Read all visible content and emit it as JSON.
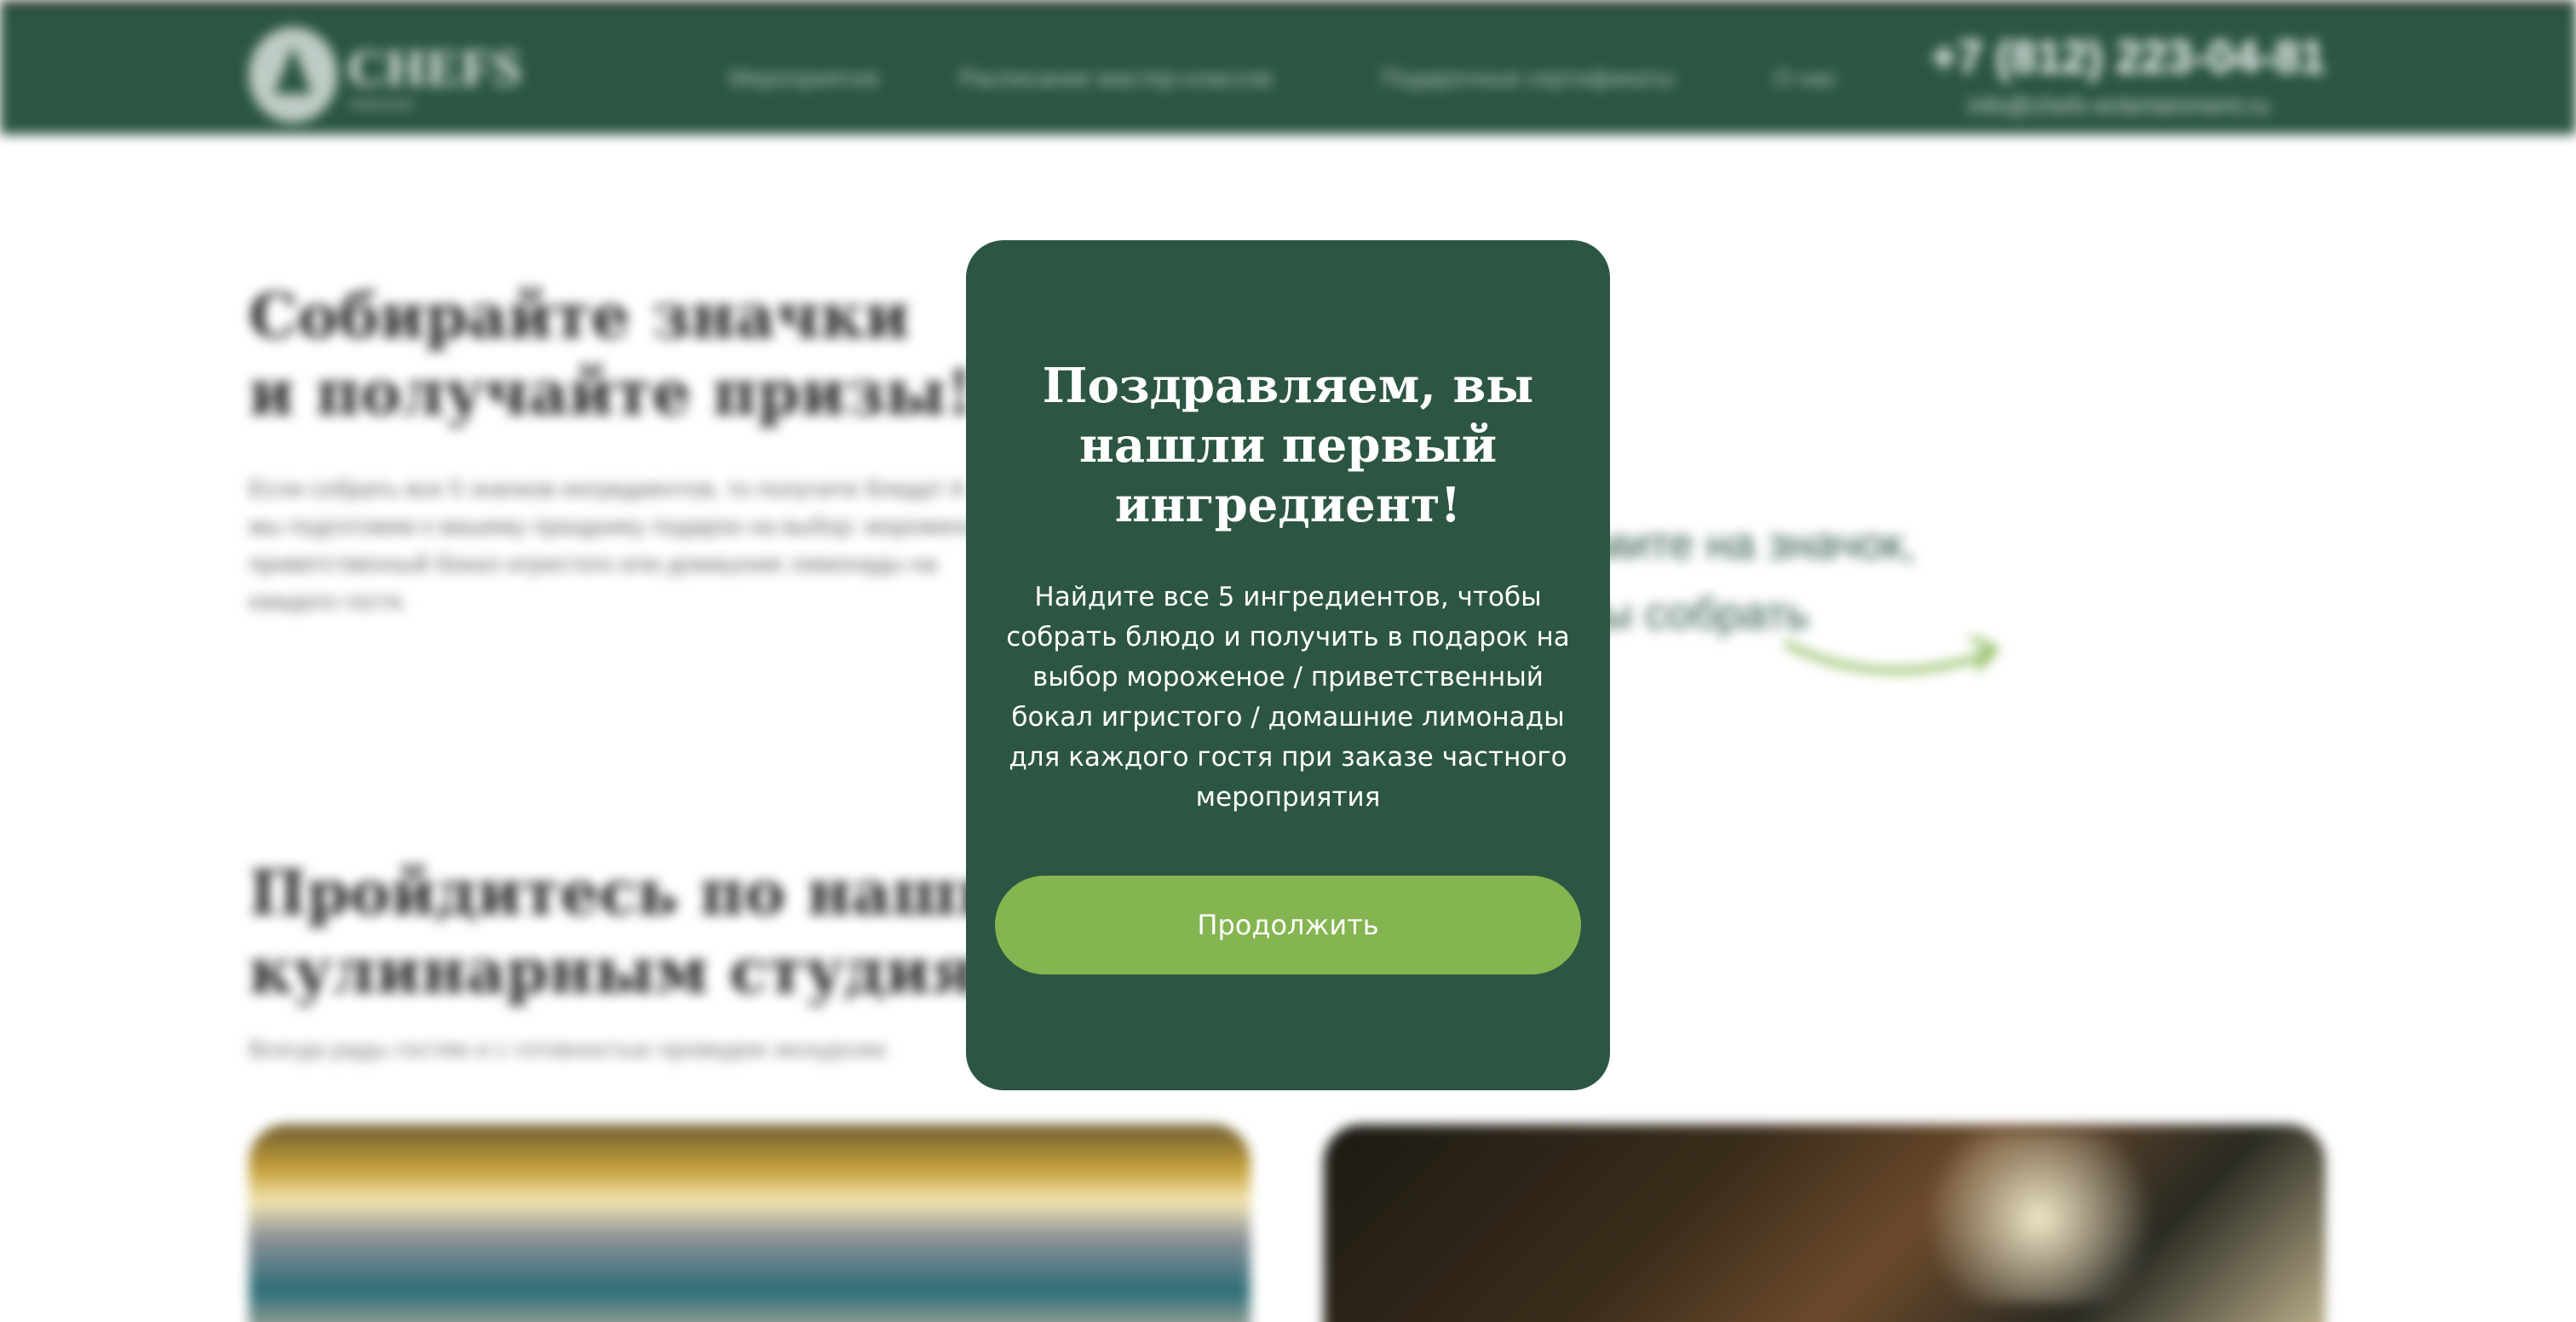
{
  "header": {
    "logo_text": "CHEFS",
    "logo_sub": "Masterclass",
    "nav": [
      "Мероприятия",
      "Расписание мастер-классов",
      "Подарочные сертификаты",
      "О нас"
    ],
    "phone": "+7 (812) 223-04-81",
    "email": "info@chefs-entertainment.ru"
  },
  "background": {
    "heading_line1": "Собирайте значки",
    "heading_line2": "и получайте призы!",
    "paragraph": "Если собрать все 5 значков ингредиентов, то получите блюдо! А мы подготовим к вашему празднику подарок на выбор: мороженое, приветственный бокал игристого или домашние лимонады на каждого гостя.",
    "side_text_line1": "Нажмите на значок,",
    "side_text_line2": "чтобы собрать",
    "heading2_line1": "Пройдитесь по нашим",
    "heading2_line2": "кулинарным студиям",
    "paragraph2": "Всегда рады гостям и с готовностью проведем экскурсию"
  },
  "modal": {
    "title": "Поздравляем, вы нашли первый ингредиент!",
    "text": "Найдите все 5 ингредиентов, чтобы собрать блюдо и получить в подарок на выбор мороженое / приветственный бокал игристого / домашние лимонады для каждого гостя при заказе частного мероприятия",
    "button_label": "Продолжить"
  },
  "colors": {
    "brand_green": "#2c5642",
    "accent_green": "#84b550",
    "text_white": "#ffffff"
  }
}
